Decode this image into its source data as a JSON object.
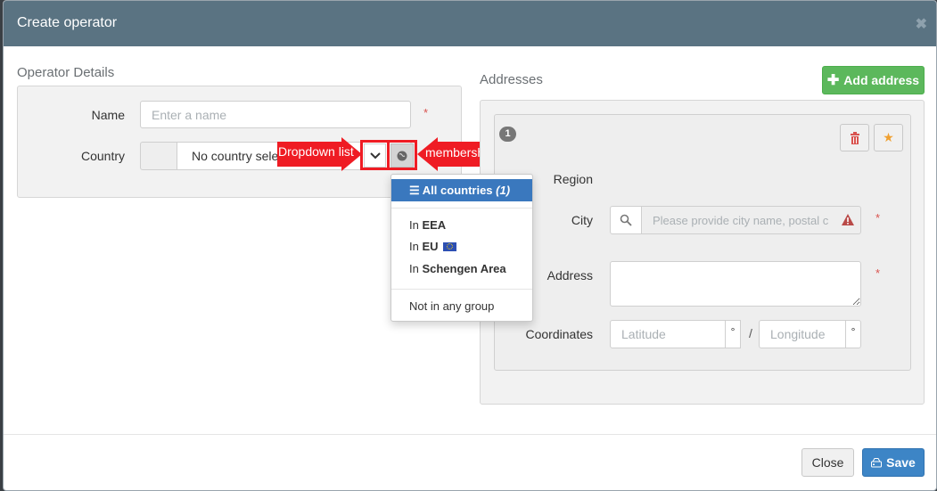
{
  "modal": {
    "title": "Create operator",
    "close_glyph": "✖"
  },
  "operator": {
    "section_title": "Operator Details",
    "name_label": "Name",
    "name_placeholder": "Enter a name",
    "required_mark": "*",
    "country_label": "Country",
    "country_value": "No country selec"
  },
  "annotations": {
    "dropdown_list": "Dropdown list",
    "membership": "membership",
    "color": "#ef1c24"
  },
  "dropdown": {
    "active_label": "All countries",
    "active_count": "(1)",
    "items": [
      {
        "prefix": "In",
        "name": "EEA"
      },
      {
        "prefix": "In",
        "name": "EU"
      },
      {
        "prefix": "In",
        "name": "Schengen Area"
      }
    ],
    "none_label": "Not in any group"
  },
  "addresses": {
    "section_title": "Addresses",
    "add_label": "Add address",
    "index": "1",
    "region_label": "Region",
    "city_label": "City",
    "city_placeholder": "Please provide city name, postal c",
    "address_label": "Address",
    "coordinates_label": "Coordinates",
    "lat_placeholder": "Latitude",
    "lon_placeholder": "Longitude",
    "degree": "°",
    "separator": "/"
  },
  "footer": {
    "close_label": "Close",
    "save_label": "Save"
  },
  "colors": {
    "header": "#5a7382",
    "success": "#5cb85c",
    "primary": "#3d85c6",
    "danger": "#d9534f"
  }
}
